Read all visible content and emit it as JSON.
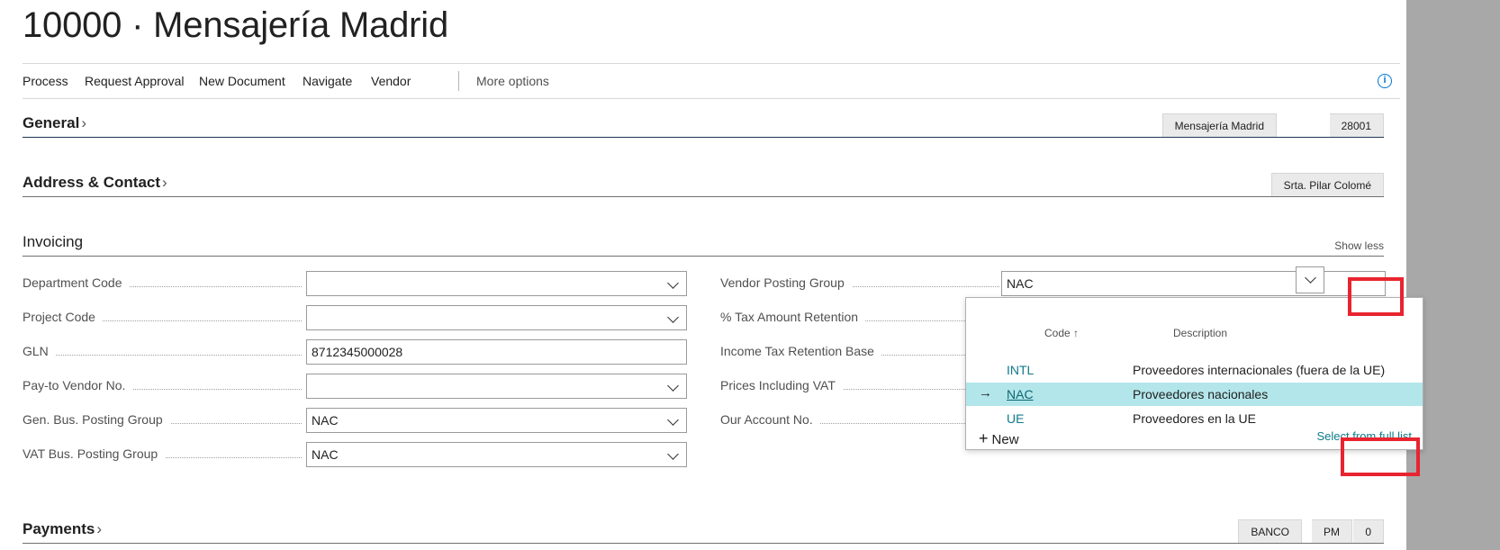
{
  "page": {
    "title": "10000 · Mensajería Madrid"
  },
  "actions": {
    "process": "Process",
    "request_approval": "Request Approval",
    "new_document": "New Document",
    "navigate": "Navigate",
    "vendor": "Vendor",
    "more_options": "More options",
    "info": "i"
  },
  "general": {
    "title": "General",
    "chevron": "›",
    "summary": [
      "Mensajería Madrid",
      "28001"
    ]
  },
  "address": {
    "title": "Address & Contact",
    "chevron": "›",
    "summary": [
      "Srta. Pilar Colomé"
    ]
  },
  "invoicing": {
    "title": "Invoicing",
    "show_less": "Show less",
    "left_fields": [
      {
        "label": "Department Code",
        "value": ""
      },
      {
        "label": "Project Code",
        "value": ""
      },
      {
        "label": "GLN",
        "value": "8712345000028"
      },
      {
        "label": "Pay-to Vendor No.",
        "value": ""
      },
      {
        "label": "Gen. Bus. Posting Group",
        "value": "NAC"
      },
      {
        "label": "VAT Bus. Posting Group",
        "value": "NAC"
      }
    ],
    "right_fields": [
      {
        "label": "Vendor Posting Group",
        "value": "NAC"
      },
      {
        "label": "% Tax Amount Retention"
      },
      {
        "label": "Income Tax Retention Base"
      },
      {
        "label": "Prices Including VAT"
      },
      {
        "label": "Our Account No."
      }
    ]
  },
  "lookup": {
    "col_code": "Code ↑",
    "col_description": "Description",
    "rows": [
      {
        "code": "INTL",
        "description": "Proveedores internacionales (fuera de la UE)"
      },
      {
        "code": "NAC",
        "description": "Proveedores nacionales"
      },
      {
        "code": "UE",
        "description": "Proveedores en la UE"
      }
    ],
    "selected_arrow": "→",
    "new_plus": "+",
    "new_label": "New",
    "select_full_list": "Select from full list"
  },
  "payments": {
    "title": "Payments",
    "chevron": "›",
    "summary": [
      "BANCO",
      "PM",
      "0"
    ]
  },
  "colors": {
    "accent": "#0f7b8a",
    "selected_row": "#b3e6ea",
    "highlight": "#e8242f"
  }
}
